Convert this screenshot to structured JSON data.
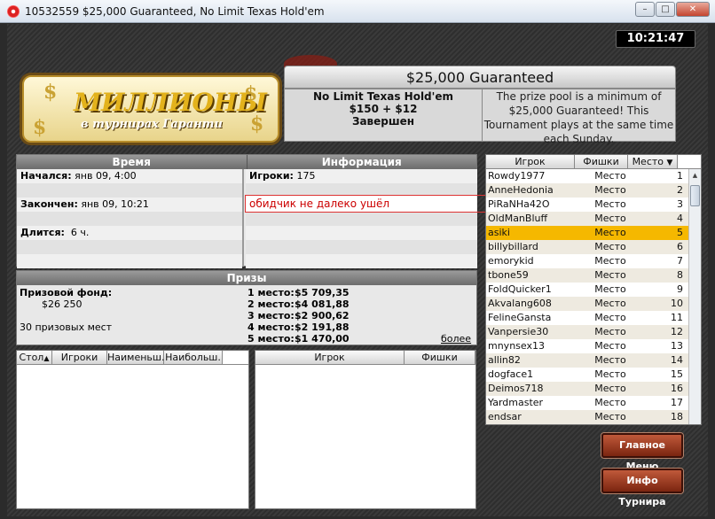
{
  "window": {
    "title": "10532559 $25,000 Guaranteed, No Limit Texas Hold'em",
    "minimize": "–",
    "maximize": "□",
    "close": "✕"
  },
  "clock": "10:21:47",
  "logo": {
    "line1": "МИЛЛИОНЫ",
    "line2": "в турнирах Гаранти",
    "dollar_glyph": "$"
  },
  "tournament": {
    "title": "$25,000 Guaranteed",
    "game": "No Limit Texas Hold'em",
    "buyin": "$150 + $12",
    "status": "Завершен",
    "description": "The prize pool is a minimum of $25,000 Guaranteed! This Tournament plays at the same time each Sunday."
  },
  "info_panel": {
    "time_header": "Время",
    "info_header": "Информация",
    "started_label": "Начался:",
    "started_value": "янв 09, 4:00",
    "ended_label": "Закончен:",
    "ended_value": "янв 09, 10:21",
    "duration_label": "Длится:",
    "duration_value": "6 ч.",
    "players_label": "Игроки:",
    "players_value": "175"
  },
  "overlay_text": "обидчик не далеко ушёл",
  "prizes": {
    "header": "Призы",
    "pool_label": "Призовой фонд:",
    "pool_value": "$26 250",
    "paid_places": "30 призовых мест",
    "places": [
      {
        "label": "1 место:",
        "value": "$5 709,35"
      },
      {
        "label": "2 место:",
        "value": "$4 081,88"
      },
      {
        "label": "3 место:",
        "value": "$2 900,62"
      },
      {
        "label": "4 место:",
        "value": "$2 191,88"
      },
      {
        "label": "5 место:",
        "value": "$1 470,00"
      }
    ],
    "more_link": "более"
  },
  "tables_list": {
    "columns": [
      "Стол",
      "Игроки",
      "Наименьш.",
      "Наибольш."
    ],
    "sort_arrow": "▲"
  },
  "table_players": {
    "columns": [
      "Игрок",
      "Фишки"
    ]
  },
  "players_list": {
    "columns": [
      "Игрок",
      "Фишки",
      "Место"
    ],
    "sort_arrow": "▼",
    "rows": [
      {
        "name": "Rowdy1977",
        "chips": "Место",
        "place": "1"
      },
      {
        "name": "AnneHedonia",
        "chips": "Место",
        "place": "2"
      },
      {
        "name": "PiRaNHa42O",
        "chips": "Место",
        "place": "3"
      },
      {
        "name": "OldManBluff",
        "chips": "Место",
        "place": "4"
      },
      {
        "name": "asiki",
        "chips": "Место",
        "place": "5"
      },
      {
        "name": "billybillard",
        "chips": "Место",
        "place": "6"
      },
      {
        "name": "emorykid",
        "chips": "Место",
        "place": "7"
      },
      {
        "name": "tbone59",
        "chips": "Место",
        "place": "8"
      },
      {
        "name": "FoldQuicker1",
        "chips": "Место",
        "place": "9"
      },
      {
        "name": "Akvalang608",
        "chips": "Место",
        "place": "10"
      },
      {
        "name": "FelineGansta",
        "chips": "Место",
        "place": "11"
      },
      {
        "name": "Vanpersie30",
        "chips": "Место",
        "place": "12"
      },
      {
        "name": "mnynsex13",
        "chips": "Место",
        "place": "13"
      },
      {
        "name": "allin82",
        "chips": "Место",
        "place": "14"
      },
      {
        "name": "dogface1",
        "chips": "Место",
        "place": "15"
      },
      {
        "name": "Deimos718",
        "chips": "Место",
        "place": "16"
      },
      {
        "name": "Yardmaster",
        "chips": "Место",
        "place": "17"
      },
      {
        "name": "endsar",
        "chips": "Место",
        "place": "18"
      }
    ],
    "selected_index": 4,
    "scroll_up": "▲"
  },
  "buttons": {
    "main_menu": "Главное Меню",
    "tournament_info": "Инфо Турнира"
  }
}
